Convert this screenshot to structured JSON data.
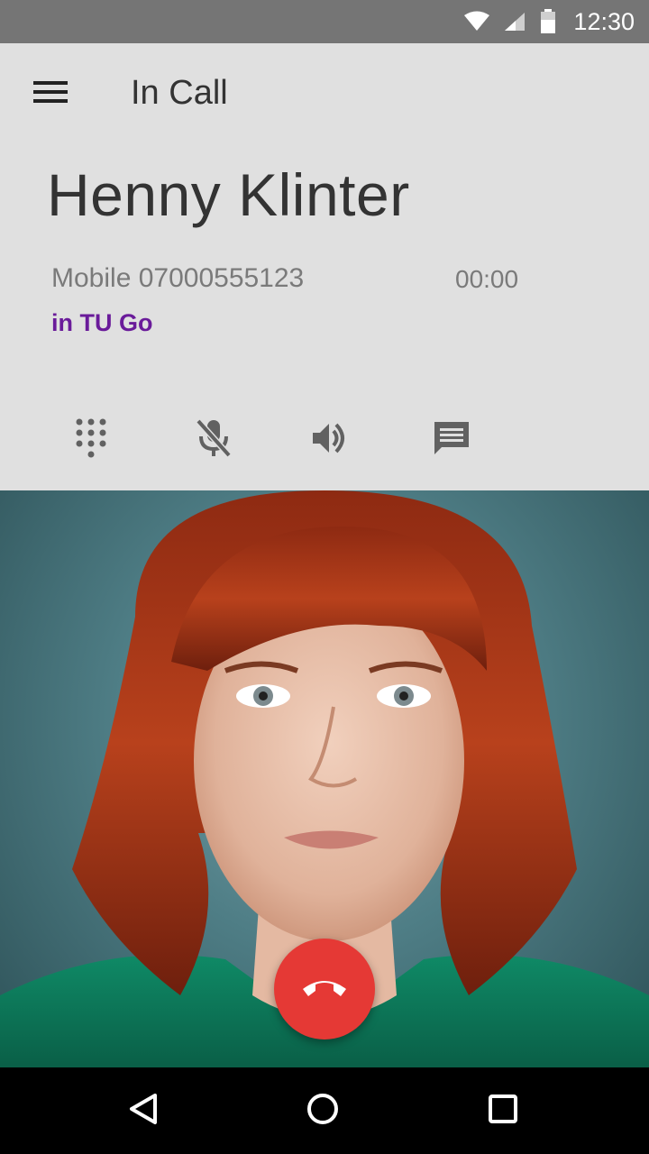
{
  "status_bar": {
    "time": "12:30",
    "icons": [
      "wifi-icon",
      "signal-icon",
      "battery-icon"
    ]
  },
  "toolbar": {
    "title": "In Call",
    "menu_icon": "hamburger-menu-icon"
  },
  "call": {
    "caller_name": "Henny Klinter",
    "number_label": "Mobile 07000555123",
    "duration": "00:00",
    "account": "in TU Go"
  },
  "actions": [
    {
      "name": "dialpad",
      "icon": "dialpad-icon"
    },
    {
      "name": "mute",
      "icon": "mic-off-icon"
    },
    {
      "name": "speaker",
      "icon": "volume-up-icon"
    },
    {
      "name": "message",
      "icon": "message-icon"
    }
  ],
  "end_call": {
    "icon": "call-end-icon",
    "color": "#e53935"
  },
  "nav": {
    "items": [
      "back-icon",
      "home-icon",
      "recents-icon"
    ]
  },
  "colors": {
    "status_bar": "#757575",
    "panel": "#e0e0e0",
    "account_accent": "#6a1b9a",
    "end_call": "#e53935"
  }
}
